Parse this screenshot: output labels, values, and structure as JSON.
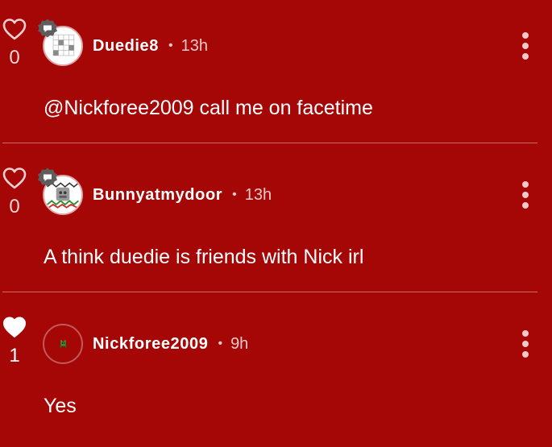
{
  "theme": {
    "background": "#a50606",
    "text": "#ffffff",
    "muted": "#f1c9c9"
  },
  "comments": [
    {
      "username": "Duedie8",
      "separator": "•",
      "time": "13h",
      "text": "@Nickforee2009 call me on facetime",
      "likes": "0",
      "liked": false,
      "avatar_icon": "crossword-avatar",
      "badge_icon": "chat-bubble-badge-icon",
      "more_icon": "more-vertical-icon"
    },
    {
      "username": "Bunnyatmydoor",
      "separator": "•",
      "time": "13h",
      "text": "A think duedie is friends with Nick irl",
      "likes": "0",
      "liked": false,
      "avatar_icon": "collage-avatar",
      "badge_icon": "chat-bubble-badge-icon",
      "more_icon": "more-vertical-icon"
    },
    {
      "username": "Nickforee2009",
      "separator": "•",
      "time": "9h",
      "text": "Yes",
      "likes": "1",
      "liked": true,
      "avatar_icon": "pixel-sprite-avatar",
      "more_icon": "more-vertical-icon"
    }
  ]
}
